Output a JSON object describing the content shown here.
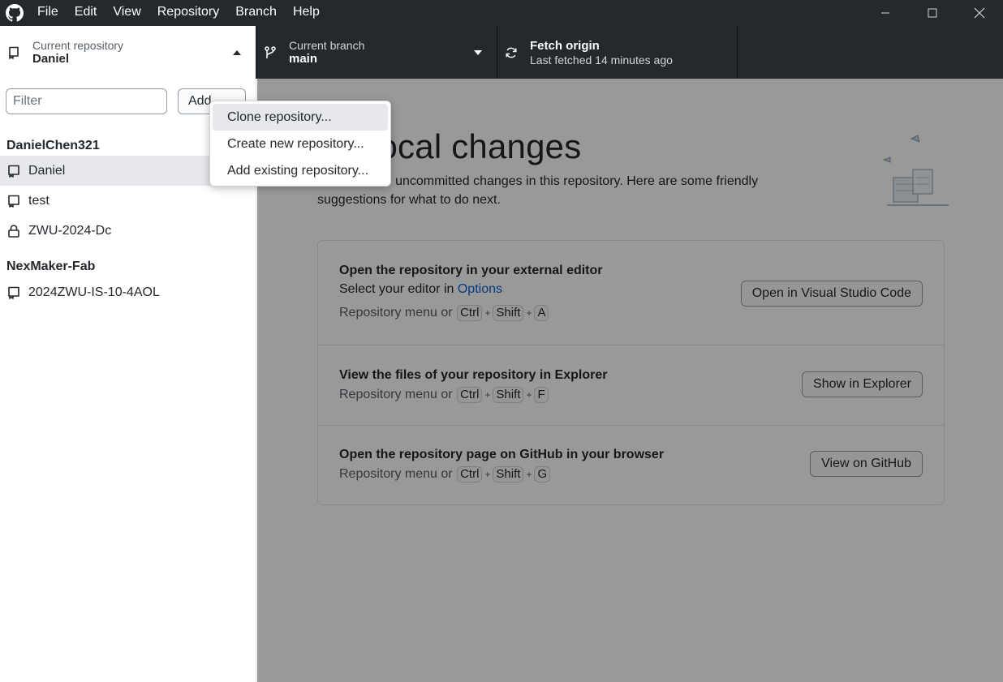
{
  "menu": {
    "logo_icon": "github-octocat-icon",
    "items": [
      "File",
      "Edit",
      "View",
      "Repository",
      "Branch",
      "Help"
    ]
  },
  "toolbar": {
    "repo": {
      "label": "Current repository",
      "value": "Daniel"
    },
    "branch": {
      "label": "Current branch",
      "value": "main"
    },
    "fetch": {
      "title": "Fetch origin",
      "subtitle": "Last fetched 14 minutes ago"
    }
  },
  "sidebar": {
    "filter_placeholder": "Filter",
    "add_label": "Add",
    "groups": [
      {
        "name": "DanielChen321",
        "repos": [
          {
            "name": "Daniel",
            "icon": "repo-icon",
            "selected": true
          },
          {
            "name": "test",
            "icon": "repo-icon"
          },
          {
            "name": "ZWU-2024-Dc",
            "icon": "lock-icon"
          }
        ]
      },
      {
        "name": "NexMaker-Fab",
        "repos": [
          {
            "name": "2024ZWU-IS-10-4AOL",
            "icon": "repo-icon"
          }
        ]
      }
    ]
  },
  "add_menu": {
    "items": [
      "Clone repository...",
      "Create new repository...",
      "Add existing repository..."
    ],
    "highlighted_index": 0
  },
  "main": {
    "heading": "No local changes",
    "heading_visible": "ocal changes",
    "subtext_visible": "uncommitted changes in this repository. Here are some friendly",
    "subtext_line2": "suggestions for what to do next.",
    "cards": [
      {
        "title": "Open the repository in your external editor",
        "desc_prefix": "Select your editor in ",
        "desc_link": "Options",
        "shortcut_prefix": "Repository menu or",
        "keys": [
          "Ctrl",
          "Shift",
          "A"
        ],
        "button": "Open in Visual Studio Code"
      },
      {
        "title": "View the files of your repository in Explorer",
        "shortcut_prefix": "Repository menu or",
        "keys": [
          "Ctrl",
          "Shift",
          "F"
        ],
        "button": "Show in Explorer"
      },
      {
        "title": "Open the repository page on GitHub in your browser",
        "shortcut_prefix": "Repository menu or",
        "keys": [
          "Ctrl",
          "Shift",
          "G"
        ],
        "button": "View on GitHub"
      }
    ]
  },
  "colors": {
    "titlebar": "#24292e",
    "link": "#0366d6",
    "selected_row": "#e6e8eb"
  }
}
